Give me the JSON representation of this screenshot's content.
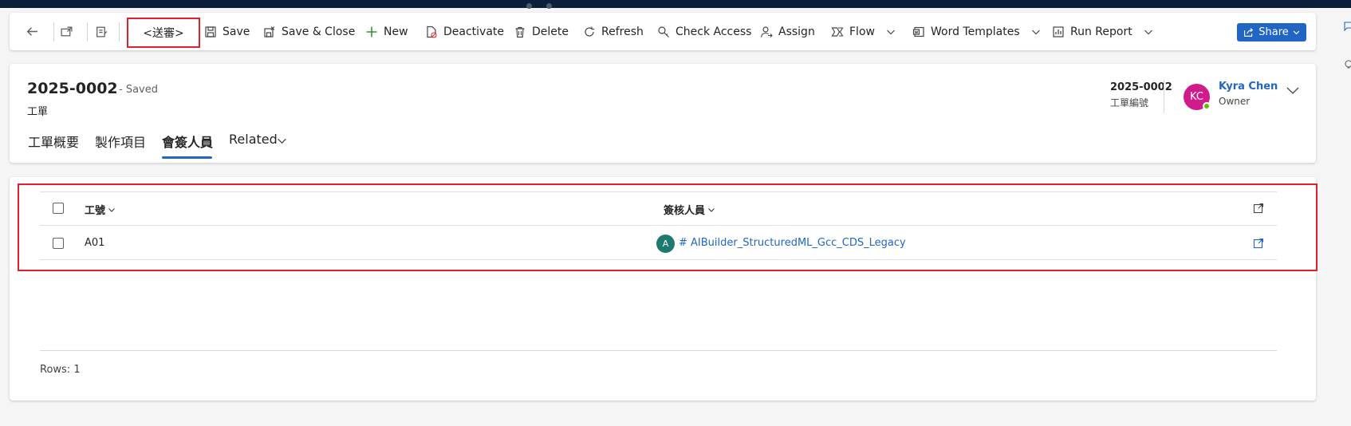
{
  "toolbar": {
    "back_icon": "back-arrow-icon",
    "submit_label": "<送審>",
    "save_label": "Save",
    "save_close_label": "Save & Close",
    "new_label": "New",
    "deactivate_label": "Deactivate",
    "delete_label": "Delete",
    "refresh_label": "Refresh",
    "check_access_label": "Check Access",
    "assign_label": "Assign",
    "flow_label": "Flow",
    "word_templates_label": "Word Templates",
    "run_report_label": "Run Report",
    "share_label": "Share"
  },
  "record": {
    "title": "2025-0002",
    "status": "- Saved",
    "entity": "工單",
    "header_field_value": "2025-0002",
    "header_field_label": "工單編號",
    "owner_initials": "KC",
    "owner_name": "Kyra Chen",
    "owner_role": "Owner"
  },
  "tabs": [
    {
      "label": "工單概要"
    },
    {
      "label": "製作項目"
    },
    {
      "label": "會簽人員",
      "active": true
    },
    {
      "label": "Related"
    }
  ],
  "grid": {
    "columns": [
      "工號",
      "簽核人員"
    ],
    "rows": [
      {
        "job_no": "A01",
        "approver_initial": "A",
        "approver": "# AIBuilder_StructuredML_Gcc_CDS_Legacy"
      }
    ],
    "rows_count": "Rows: 1"
  },
  "colors": {
    "accent": "#2266c5",
    "highlight_border": "#e0202a",
    "avatar_owner": "#d11b8a",
    "avatar_row": "#1e7a6e",
    "presence": "#6bb700"
  }
}
